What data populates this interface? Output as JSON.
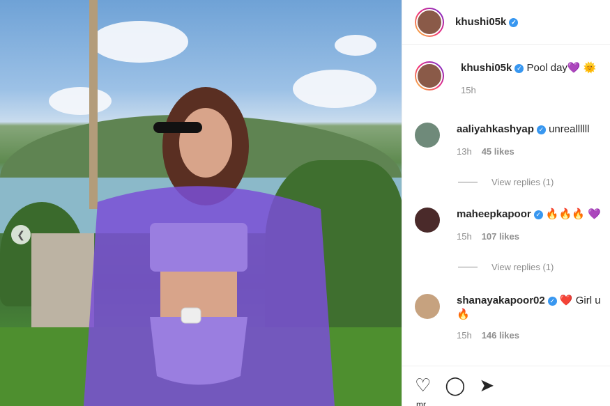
{
  "post": {
    "username": "khushi05k",
    "caption": {
      "user": "khushi05k",
      "text": "Pool day💜 🌞",
      "time": "15h"
    },
    "comments": [
      {
        "user": "aaliyahkashyap",
        "text": "unreallllll",
        "time": "13h",
        "likes": "45 likes",
        "replies": "View replies (1)"
      },
      {
        "user": "maheepkapoor",
        "text": "🔥🔥🔥 💜",
        "time": "15h",
        "likes": "107 likes",
        "replies": "View replies (1)"
      },
      {
        "user": "shanayakapoor02",
        "text": "❤️ Girl u",
        "text2": "🔥",
        "time": "15h",
        "likes": "146 likes"
      }
    ],
    "actions": {
      "like_icon": "♡",
      "comment_icon": "◯",
      "share_icon": "➤"
    },
    "likes_cut": "mr"
  },
  "colors": {
    "verified": "#3897f0",
    "accent": "#262626"
  }
}
